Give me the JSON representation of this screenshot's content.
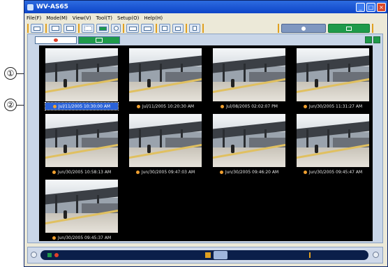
{
  "callouts": {
    "one": "①",
    "two": "②"
  },
  "window": {
    "title": "WV-AS65"
  },
  "menu": [
    {
      "label": "File(F)"
    },
    {
      "label": "Mode(M)"
    },
    {
      "label": "View(V)"
    },
    {
      "label": "Tool(T)"
    },
    {
      "label": "Setup(O)"
    },
    {
      "label": "Help(H)"
    }
  ],
  "toolbar": {
    "icons": [
      "camera-icon",
      "layout-single-icon",
      "layout-quad-icon",
      "layout-grid-icon",
      "cif-icon",
      "timer-icon",
      "window-icon",
      "monitor-icon",
      "print-icon",
      "email-icon",
      "delete-icon"
    ],
    "accent": "#e0a020"
  },
  "thumbnails": [
    {
      "caption": "Jul/11/2005 10:30:00 AM",
      "selected": true
    },
    {
      "caption": "Jul/11/2005 10:20:30 AM",
      "selected": false
    },
    {
      "caption": "Jul/08/2005 02:02:07 PM",
      "selected": false
    },
    {
      "caption": "Jun/30/2005 11:31:27 AM",
      "selected": false
    },
    {
      "caption": "Jun/30/2005 10:58:13 AM",
      "selected": false
    },
    {
      "caption": "Jun/30/2005 09:47:03 AM",
      "selected": false
    },
    {
      "caption": "Jun/30/2005 09:46:20 AM",
      "selected": false
    },
    {
      "caption": "Jun/30/2005 09:45:47 AM",
      "selected": false
    },
    {
      "caption": "Jun/30/2005 09:45:37 AM",
      "selected": false
    }
  ],
  "colors": {
    "selected_caption": "#2a62d8",
    "status_dot": "#f0a030",
    "viewer_bg": "#000000"
  }
}
